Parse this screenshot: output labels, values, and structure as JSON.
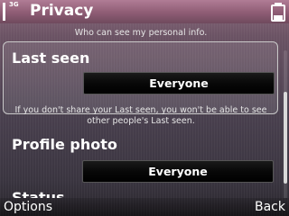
{
  "status_bar": {
    "network_type": "3G",
    "title": "Privacy",
    "signal_level": 1.0,
    "battery_level": 0.35,
    "signal_icon": "signal-strength-icon",
    "battery_icon": "battery-icon"
  },
  "content": {
    "top_caption": "Who can see my personal info.",
    "last_seen": {
      "label": "Last seen",
      "value": "Everyone"
    },
    "last_seen_info_line1": "If you don't share your Last seen, you won't be able to see",
    "last_seen_info_line2": "other people's Last seen.",
    "profile_photo": {
      "label": "Profile photo",
      "value": "Everyone"
    },
    "next_item_partial": "Status"
  },
  "scrollbar": {
    "position": 0.55,
    "visible_fraction": 0.55
  },
  "softkeys": {
    "left": "Options",
    "right": "Back"
  },
  "colors": {
    "title_bar": "#8e5c74",
    "background": "#4b4150",
    "value_button": "#000000"
  }
}
